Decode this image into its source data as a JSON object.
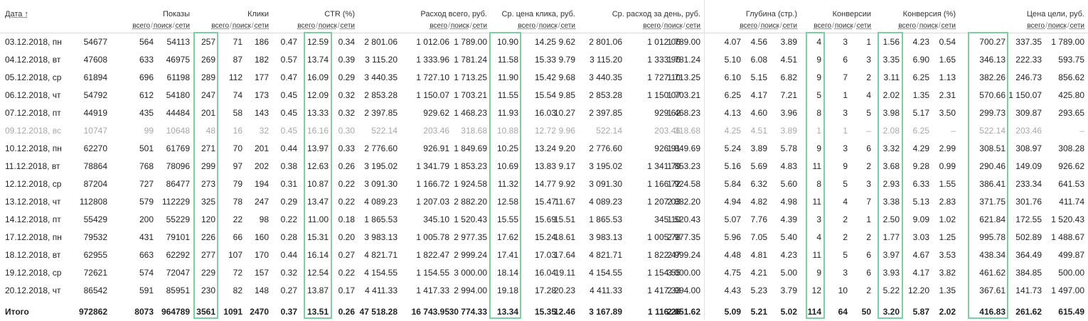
{
  "header": {
    "date_label": "Дата ↑",
    "groups": [
      "Показы",
      "Клики",
      "CTR (%)",
      "Расход всего, руб.",
      "Ср. цена клика, руб.",
      "Ср. расход за день, руб.",
      "Глубина (стр.)",
      "Конверсии",
      "Конверсия (%)",
      "Цена цели, руб."
    ],
    "sub": {
      "all": "всего",
      "search": "поиск",
      "networks": "сети",
      "sep": "/"
    }
  },
  "rows": [
    {
      "date": "03.12.2018, пн",
      "muted": false,
      "v": [
        "54677",
        "564",
        "54113",
        "257",
        "71",
        "186",
        "0.47",
        "12.59",
        "0.34",
        "2 801.06",
        "1 012.06",
        "1 789.00",
        "10.90",
        "14.25",
        "9.62",
        "2 801.06",
        "1 012.06",
        "1 789.00",
        "4.07",
        "4.56",
        "3.89",
        "4",
        "3",
        "1",
        "1.56",
        "4.23",
        "0.54",
        "700.27",
        "337.35",
        "1 789.00"
      ]
    },
    {
      "date": "04.12.2018, вт",
      "muted": false,
      "v": [
        "47608",
        "633",
        "46975",
        "269",
        "87",
        "182",
        "0.57",
        "13.74",
        "0.39",
        "3 115.20",
        "1 333.96",
        "1 781.24",
        "11.58",
        "15.33",
        "9.79",
        "3 115.20",
        "1 333.96",
        "1 781.24",
        "5.10",
        "6.08",
        "4.51",
        "9",
        "6",
        "3",
        "3.35",
        "6.90",
        "1.65",
        "346.13",
        "222.33",
        "593.75"
      ]
    },
    {
      "date": "05.12.2018, ср",
      "muted": false,
      "v": [
        "61894",
        "696",
        "61198",
        "289",
        "112",
        "177",
        "0.47",
        "16.09",
        "0.29",
        "3 440.35",
        "1 727.10",
        "1 713.25",
        "11.90",
        "15.42",
        "9.68",
        "3 440.35",
        "1 727.10",
        "1 713.25",
        "6.10",
        "5.15",
        "6.82",
        "9",
        "7",
        "2",
        "3.11",
        "6.25",
        "1.13",
        "382.26",
        "246.73",
        "856.62"
      ]
    },
    {
      "date": "06.12.2018, чт",
      "muted": false,
      "v": [
        "54792",
        "612",
        "54180",
        "247",
        "74",
        "173",
        "0.45",
        "12.09",
        "0.32",
        "2 853.28",
        "1 150.07",
        "1 703.21",
        "11.55",
        "15.54",
        "9.85",
        "2 853.28",
        "1 150.07",
        "1 703.21",
        "6.25",
        "4.17",
        "7.21",
        "5",
        "1",
        "4",
        "2.02",
        "1.35",
        "2.31",
        "570.66",
        "1 150.07",
        "425.80"
      ]
    },
    {
      "date": "07.12.2018, пт",
      "muted": false,
      "v": [
        "44919",
        "435",
        "44484",
        "201",
        "58",
        "143",
        "0.45",
        "13.33",
        "0.32",
        "2 397.85",
        "929.62",
        "1 468.23",
        "11.93",
        "16.03",
        "10.27",
        "2 397.85",
        "929.62",
        "1 468.23",
        "4.13",
        "4.60",
        "3.96",
        "8",
        "3",
        "5",
        "3.98",
        "5.17",
        "3.50",
        "299.73",
        "309.87",
        "293.65"
      ]
    },
    {
      "date": "09.12.2018, вс",
      "muted": true,
      "v": [
        "10747",
        "99",
        "10648",
        "48",
        "16",
        "32",
        "0.45",
        "16.16",
        "0.30",
        "522.14",
        "203.46",
        "318.68",
        "10.88",
        "12.72",
        "9.96",
        "522.14",
        "203.46",
        "318.68",
        "4.25",
        "4.51",
        "3.89",
        "1",
        "1",
        "–",
        "2.08",
        "6.25",
        "–",
        "522.14",
        "203.46",
        "–"
      ]
    },
    {
      "date": "10.12.2018, пн",
      "muted": false,
      "v": [
        "62270",
        "501",
        "61769",
        "271",
        "70",
        "201",
        "0.44",
        "13.97",
        "0.33",
        "2 776.60",
        "926.91",
        "1 849.69",
        "10.25",
        "13.24",
        "9.20",
        "2 776.60",
        "926.91",
        "1 849.69",
        "5.24",
        "3.89",
        "5.78",
        "9",
        "3",
        "6",
        "3.32",
        "4.29",
        "2.99",
        "308.51",
        "308.97",
        "308.28"
      ]
    },
    {
      "date": "11.12.2018, вт",
      "muted": false,
      "v": [
        "78864",
        "768",
        "78096",
        "299",
        "97",
        "202",
        "0.38",
        "12.63",
        "0.26",
        "3 195.02",
        "1 341.79",
        "1 853.23",
        "10.69",
        "13.83",
        "9.17",
        "3 195.02",
        "1 341.79",
        "1 853.23",
        "5.16",
        "5.69",
        "4.83",
        "11",
        "9",
        "2",
        "3.68",
        "9.28",
        "0.99",
        "290.46",
        "149.09",
        "926.62"
      ]
    },
    {
      "date": "12.12.2018, ср",
      "muted": false,
      "v": [
        "87204",
        "727",
        "86477",
        "273",
        "79",
        "194",
        "0.31",
        "10.87",
        "0.22",
        "3 091.30",
        "1 166.72",
        "1 924.58",
        "11.32",
        "14.77",
        "9.92",
        "3 091.30",
        "1 166.72",
        "1 924.58",
        "5.84",
        "6.32",
        "5.60",
        "8",
        "5",
        "3",
        "2.93",
        "6.33",
        "1.55",
        "386.41",
        "233.34",
        "641.53"
      ]
    },
    {
      "date": "13.12.2018, чт",
      "muted": false,
      "v": [
        "112808",
        "579",
        "112229",
        "325",
        "78",
        "247",
        "0.29",
        "13.47",
        "0.22",
        "4 089.23",
        "1 207.03",
        "2 882.20",
        "12.58",
        "15.47",
        "11.67",
        "4 089.23",
        "1 207.03",
        "2 882.20",
        "4.94",
        "4.82",
        "4.98",
        "11",
        "4",
        "7",
        "3.38",
        "5.13",
        "2.83",
        "371.75",
        "301.76",
        "411.74"
      ]
    },
    {
      "date": "14.12.2018, пт",
      "muted": false,
      "v": [
        "55429",
        "200",
        "55229",
        "120",
        "22",
        "98",
        "0.22",
        "11.00",
        "0.18",
        "1 865.53",
        "345.10",
        "1 520.43",
        "15.55",
        "15.69",
        "15.51",
        "1 865.53",
        "345.10",
        "1 520.43",
        "5.07",
        "7.76",
        "4.39",
        "3",
        "2",
        "1",
        "2.50",
        "9.09",
        "1.02",
        "621.84",
        "172.55",
        "1 520.43"
      ]
    },
    {
      "date": "17.12.2018, пн",
      "muted": false,
      "v": [
        "79532",
        "431",
        "79101",
        "226",
        "66",
        "160",
        "0.28",
        "15.31",
        "0.20",
        "3 983.13",
        "1 005.78",
        "2 977.35",
        "17.62",
        "15.24",
        "18.61",
        "3 983.13",
        "1 005.78",
        "2 977.35",
        "5.96",
        "7.05",
        "5.40",
        "4",
        "2",
        "2",
        "1.77",
        "3.03",
        "1.25",
        "995.78",
        "502.89",
        "1 488.67"
      ]
    },
    {
      "date": "18.12.2018, вт",
      "muted": false,
      "v": [
        "62955",
        "663",
        "62292",
        "277",
        "107",
        "170",
        "0.44",
        "16.14",
        "0.27",
        "4 821.71",
        "1 822.47",
        "2 999.24",
        "17.41",
        "17.03",
        "17.64",
        "4 821.71",
        "1 822.47",
        "2 999.24",
        "4.48",
        "4.81",
        "4.23",
        "11",
        "5",
        "6",
        "3.97",
        "4.67",
        "3.53",
        "438.34",
        "364.49",
        "499.87"
      ]
    },
    {
      "date": "19.12.2018, ср",
      "muted": false,
      "v": [
        "72621",
        "574",
        "72047",
        "229",
        "72",
        "157",
        "0.32",
        "12.54",
        "0.22",
        "4 154.55",
        "1 154.55",
        "3 000.00",
        "18.14",
        "16.04",
        "19.11",
        "4 154.55",
        "1 154.55",
        "3 000.00",
        "4.75",
        "4.21",
        "5.00",
        "9",
        "3",
        "6",
        "3.93",
        "4.17",
        "3.82",
        "461.62",
        "384.85",
        "500.00"
      ]
    },
    {
      "date": "20.12.2018, чт",
      "muted": false,
      "v": [
        "86542",
        "591",
        "85951",
        "230",
        "82",
        "148",
        "0.27",
        "13.87",
        "0.17",
        "4 411.33",
        "1 417.33",
        "2 994.00",
        "19.18",
        "17.28",
        "20.23",
        "4 411.33",
        "1 417.33",
        "2 994.00",
        "4.43",
        "5.23",
        "3.79",
        "12",
        "10",
        "2",
        "5.22",
        "12.20",
        "1.35",
        "367.61",
        "141.73",
        "1 497.00"
      ]
    }
  ],
  "total": {
    "date": "Итого",
    "v": [
      "972862",
      "8073",
      "964789",
      "3561",
      "1091",
      "2470",
      "0.37",
      "13.51",
      "0.26",
      "47 518.28",
      "16 743.95",
      "30 774.33",
      "13.34",
      "15.35",
      "12.46",
      "3 167.89",
      "1 116.26",
      "2 051.62",
      "5.09",
      "5.21",
      "5.02",
      "114",
      "64",
      "50",
      "3.20",
      "5.87",
      "2.02",
      "416.83",
      "261.62",
      "615.49"
    ]
  },
  "highlight_color": "#7dcfa3"
}
